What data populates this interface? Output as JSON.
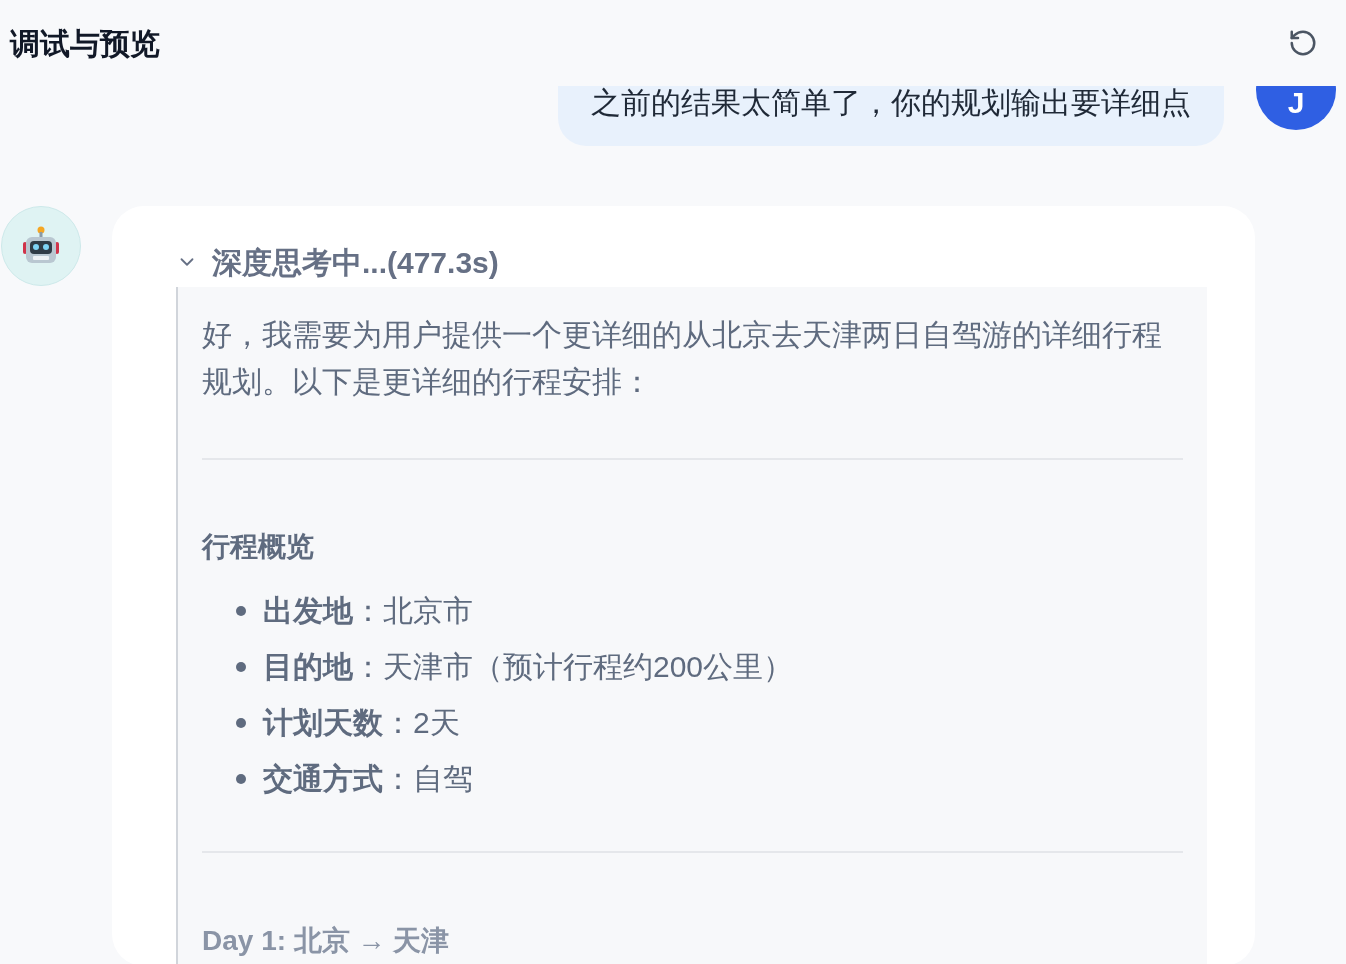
{
  "header": {
    "title": "调试与预览"
  },
  "user_message": {
    "text": "之前的结果太简单了，你的规划输出要详细点",
    "avatar": "J"
  },
  "assistant": {
    "thinking": {
      "title": "深度思考中...(477.3s)",
      "expanded": true,
      "content": [
        {
          "kind": "paragraph",
          "text": "好，我需要为用户提供一个更详细的从北京去天津两日自驾游的详细行程规划。以下是更详细的行程安排："
        },
        {
          "kind": "divider"
        },
        {
          "kind": "heading",
          "text": "行程概览"
        },
        {
          "kind": "list",
          "items": [
            "**出发地**：北京市",
            "**目的地**：天津市（预计行程约200公里）",
            "**计划天数**：2天",
            "**交通方式**：自驾"
          ]
        },
        {
          "kind": "divider"
        },
        {
          "kind": "heading",
          "text": "Day 1: 北京 → 天津"
        }
      ]
    }
  }
}
